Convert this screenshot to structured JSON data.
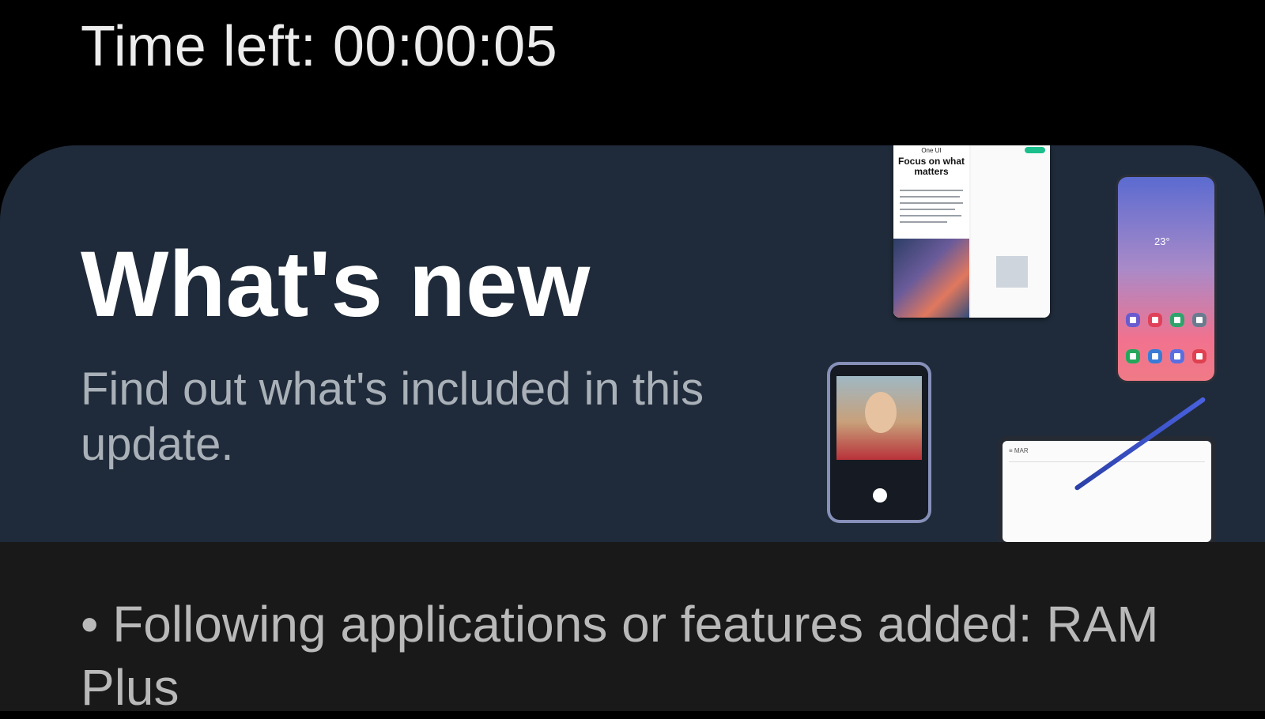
{
  "header": {
    "timer_text": "Time left: 00:00:05"
  },
  "card": {
    "title": "What's new",
    "subtitle": "Find out what's included in this update.",
    "illustration": {
      "tablet_brand": "One UI",
      "tablet_heading": "Focus on what matters",
      "phone_weather": "23°"
    }
  },
  "update_notes": {
    "items": [
      "• Following applications or features added: RAM Plus"
    ]
  },
  "colors": {
    "background": "#000000",
    "card": "#1f2b3a",
    "notes_panel": "#191919",
    "title_text": "#ffffff",
    "subtitle_text": "#a9b0b8"
  }
}
